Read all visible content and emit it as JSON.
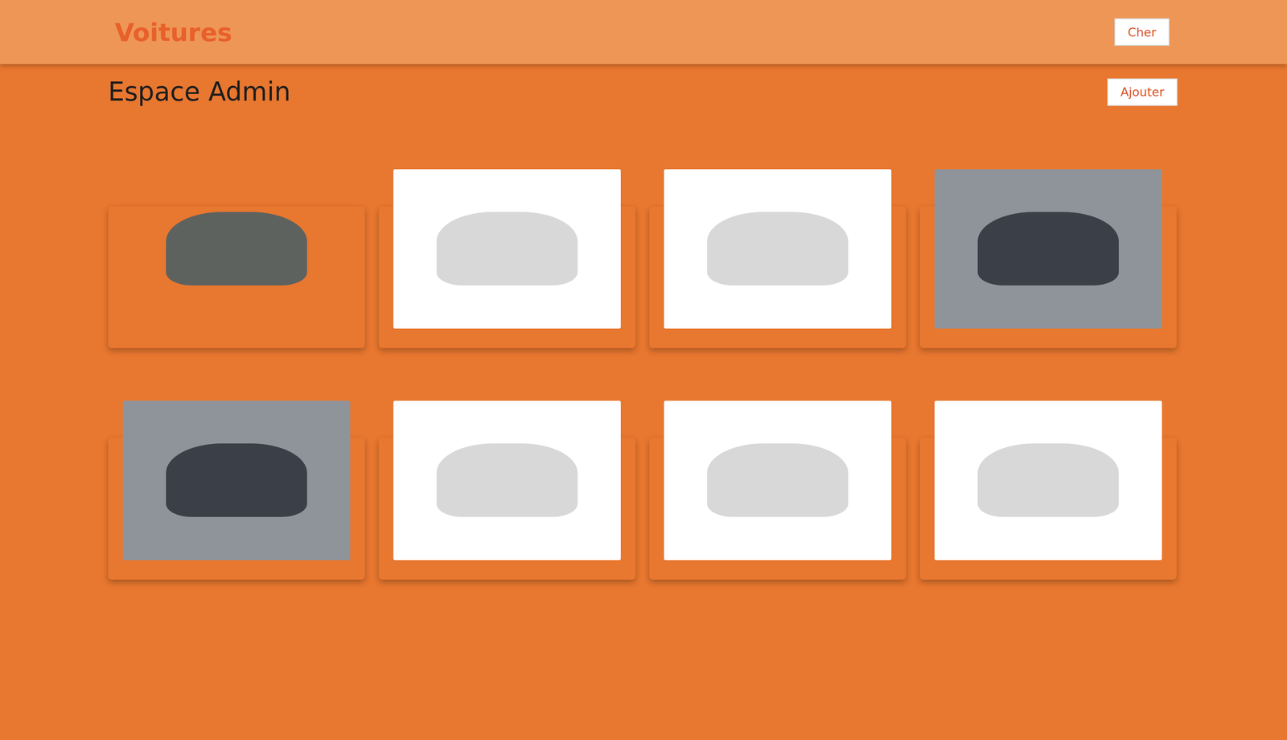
{
  "header": {
    "title": "Voitures",
    "button": "Cher"
  },
  "page": {
    "title": "Espace Admin",
    "add_button": "Ajouter"
  },
  "cars": [
    {
      "kind": "cutout"
    },
    {
      "kind": "studio"
    },
    {
      "kind": "studio"
    },
    {
      "kind": "photo"
    },
    {
      "kind": "photo"
    },
    {
      "kind": "studio"
    },
    {
      "kind": "studio"
    },
    {
      "kind": "studio"
    }
  ]
}
